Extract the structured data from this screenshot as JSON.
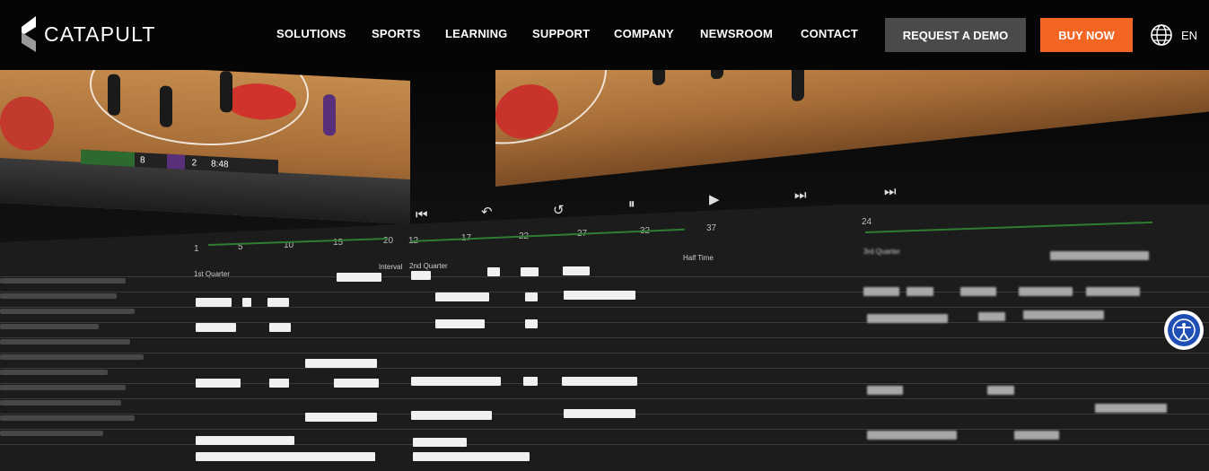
{
  "header": {
    "brand": "CATAPULT",
    "nav": [
      "SOLUTIONS",
      "SPORTS",
      "LEARNING",
      "SUPPORT",
      "COMPANY",
      "NEWSROOM",
      "CONTACT"
    ],
    "demo_button": "REQUEST A DEMO",
    "buy_button": "BUY NOW",
    "language": "EN",
    "colors": {
      "bar": "#050505",
      "demo": "#4a4a4a",
      "buy": "#f26522"
    }
  },
  "hero": {
    "scoreboard": {
      "home_score": "8",
      "away_score": "2",
      "clock": "8:48"
    },
    "timeline": {
      "ticks": [
        "1",
        "5",
        "10",
        "15",
        "20",
        "12",
        "17",
        "22",
        "27",
        "32",
        "37",
        "24"
      ],
      "markers": [
        "Interval",
        "2nd Quarter",
        "Half Time",
        "1st Quarter",
        "3rd Quarter"
      ]
    },
    "accessibility_icon": "accessibility-icon"
  }
}
